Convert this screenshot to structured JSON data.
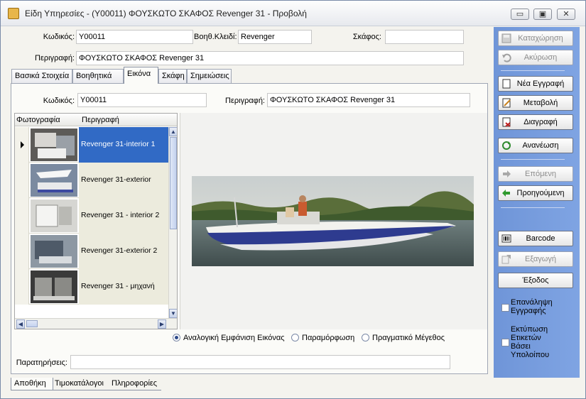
{
  "window": {
    "title": "Είδη Υπηρεσίες - (Y00011) ΦΟΥΣΚΩΤΟ ΣΚΑΦΟΣ Revenger 31 -  Προβολή"
  },
  "header": {
    "code_label": "Κωδικός:",
    "code_value": "Y00011",
    "aux_key_label": "Βοηθ.Κλειδί:",
    "aux_key_value": "Revenger",
    "vessel_label": "Σκάφος:",
    "vessel_value": "",
    "description_label": "Περιγραφή:",
    "description_value": "ΦΟΥΣΚΩΤΟ ΣΚΑΦΟΣ Revenger 31"
  },
  "tabs": [
    {
      "label": "Βασικά Στοιχεία"
    },
    {
      "label": "Βοηθητικά"
    },
    {
      "label": "Εικόνα"
    },
    {
      "label": "Σκάφη"
    },
    {
      "label": "Σημειώσεις"
    }
  ],
  "image_tab": {
    "code_label": "Κωδικός:",
    "code_value": "Y00011",
    "description_label": "Περιγραφή:",
    "description_value": "ΦΟΥΣΚΩΤΟ ΣΚΑΦΟΣ Revenger 31",
    "grid_headers": [
      "Φωτογραφία",
      "Περιγραφή"
    ],
    "photos": [
      {
        "description": "Revenger 31-interior 1",
        "selected": true
      },
      {
        "description": "Revenger 31-exterior",
        "selected": false
      },
      {
        "description": "Revenger 31 - interior 2",
        "selected": false
      },
      {
        "description": "Revenger 31-exterior 2",
        "selected": false
      },
      {
        "description": "Revenger 31 - μηχανή",
        "selected": false
      }
    ],
    "display_options": [
      {
        "label": "Αναλογική Εμφάνιση Εικόνας",
        "checked": true
      },
      {
        "label": "Παραμόρφωση",
        "checked": false
      },
      {
        "label": "Πραγματικό Μέγεθος",
        "checked": false
      }
    ],
    "notes_label": "Παρατηρήσεις:",
    "notes_value": ""
  },
  "sidebar": {
    "save": "Καταχώρηση",
    "cancel": "Ακύρωση",
    "new_record": "Νέα Εγγραφή",
    "edit": "Μεταβολή",
    "delete": "Διαγραφή",
    "refresh": "Ανανέωση",
    "next": "Επόμενη",
    "previous": "Προηγούμενη",
    "barcode": "Barcode",
    "export": "Εξαγωγή",
    "exit": "Έξοδος",
    "repeat_record": "Επανάληψη Εγγραφής",
    "print_labels": "Εκτύπωση Ετικετών Βάσει Υπολοίπου"
  },
  "bottom_tabs": [
    {
      "label": "Αποθήκη"
    },
    {
      "label": "Τιμοκατάλογοι"
    },
    {
      "label": "Πληροφορίες"
    }
  ]
}
